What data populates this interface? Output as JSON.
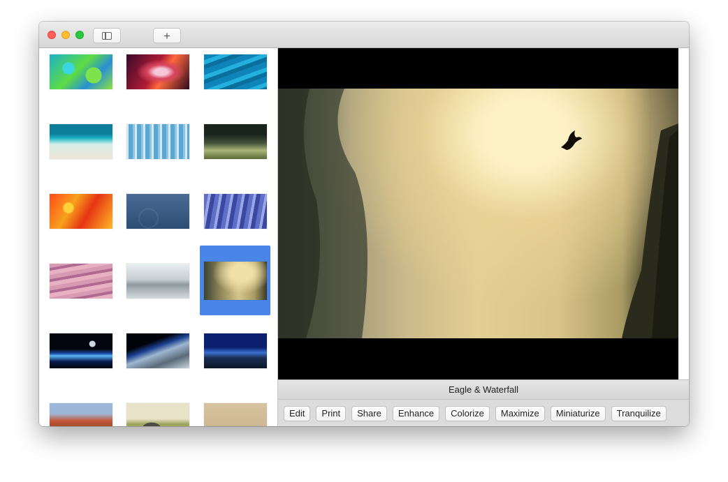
{
  "window": {
    "add_label": "+"
  },
  "gallery": {
    "thumbnails": [
      {
        "name": "thumb-green-abstract",
        "style": "radial-gradient(circle at 30% 40%, #3ad7e0 0 12%, transparent 13%), radial-gradient(circle at 70% 60%, #7ce34e 0 16%, transparent 17%), linear-gradient(135deg,#1db2c8,#5edc44 45%,#2a8fd6 70%,#8ae33b)"
      },
      {
        "name": "thumb-red-canyon",
        "style": "radial-gradient(ellipse at 55% 50%, #f6c7d9 0 14%, #d8455f 28%, transparent 50%), linear-gradient(120deg,#3a0a2a,#b01c34 45%,#ff6a3d 60%,#30081e)"
      },
      {
        "name": "thumb-blue-water",
        "style": "repeating-linear-gradient(160deg,#0e84b8 0 8px,#23b0dc 8px 14px,#0a6f9c 14px 20px)"
      },
      {
        "name": "thumb-beach",
        "style": "linear-gradient(#0c7d9a 0 28%,#1eb3c6 40%,#d6efe8 58%,#efe6d8 100%)"
      },
      {
        "name": "thumb-blue-trees",
        "style": "repeating-linear-gradient(90deg,#d6e8f2 0 3px,#5aa7d2 3px 9px,#8fc6e4 9px 12px), linear-gradient(#dce9f3,#3a8fc2)"
      },
      {
        "name": "thumb-grass",
        "style": "linear-gradient(#1a241e 0 30%,#47553c 55%,#aab67a 75%,#5b6a34)"
      },
      {
        "name": "thumb-orange-paint",
        "style": "radial-gradient(circle at 30% 40%, #ffd23a 0 10%, transparent 12%), linear-gradient(120deg,#ff4a1a,#f7a21c 35%,#e63513 60%,#ffb827)"
      },
      {
        "name": "thumb-blue-waves",
        "style": "radial-gradient(circle at 35% 70%, transparent 0 12px, rgba(255,255,255,0.08) 13px 14px, transparent 15px), linear-gradient(#4a6c95,#2c4d73)"
      },
      {
        "name": "thumb-blue-rock",
        "style": "repeating-linear-gradient(100deg,#5f6fc5 0 6px,#9aa6e6 6px 10px,#3b48a0 10px 16px)"
      },
      {
        "name": "thumb-pink-dunes",
        "style": "repeating-linear-gradient(170deg,#d69bb2 0 6px,#b16a8f 6px 10px,#e8b1c2 10px 16px)"
      },
      {
        "name": "thumb-foggy-lake",
        "style": "linear-gradient(#e9eef0,#c6cfd4 45%,#8e9aa0 60%,#d6dde0)"
      },
      {
        "name": "thumb-eagle-waterfall",
        "style": "radial-gradient(ellipse at 60% 30%, #f1e0a8 0 20%, transparent 55%), linear-gradient(90deg,#3a4230,#8b8456 25%,#d6c58a 55%,#a99b62 80%,#39392a)"
      },
      {
        "name": "thumb-earth-horizon",
        "style": "radial-gradient(circle at 68% 30%, #cfd8e6 0 4px, transparent 5px), linear-gradient(#04060f 0 45%,#1c4ea8 58%,#5ab6f5 64%,#0b1c52 80%,#02040a)"
      },
      {
        "name": "thumb-earth-space",
        "style": "linear-gradient(160deg,#02030a 0 30%,#1a3f8e 42%,#9fb6cf 55%,#5a6a7a 75%,#c9d3dc)"
      },
      {
        "name": "thumb-blue-mountains",
        "style": "linear-gradient(#0b1f6e 0 40%,#3a6fd0 55%,#1b2f55 70%,#0c1626)"
      },
      {
        "name": "thumb-el-capitan",
        "style": "linear-gradient(#9db7d8 0 30%,#c45a3a 50%,#6b2a20 100%)"
      },
      {
        "name": "thumb-elephant",
        "style": "radial-gradient(ellipse at 40% 75%, #4e4a45 0 18%, transparent 19%), linear-gradient(#e8e2c8 0 45%,#9da35b 60%,#c8b77a)"
      },
      {
        "name": "thumb-sand",
        "style": "linear-gradient(#d7c3a0,#c9b28b)"
      }
    ]
  },
  "preview": {
    "photo_style": "radial-gradient(ellipse at 62% 18%, rgba(255,244,200,0.95) 0 12%, rgba(236,212,150,0.7) 30%, transparent 60%), linear-gradient(90deg,#2e3428 0%,#6f6f58 8%,#a59d7a 18%,#cbb98a 32%,#e3cf93 50%,#d9c387 70%,#a79a62 86%,#3d3a26 93%,#1f2116 100%)",
    "caption": "Eagle & Waterfall"
  },
  "actions": [
    "Edit",
    "Print",
    "Share",
    "Enhance",
    "Colorize",
    "Maximize",
    "Miniaturize",
    "Tranquilize"
  ]
}
